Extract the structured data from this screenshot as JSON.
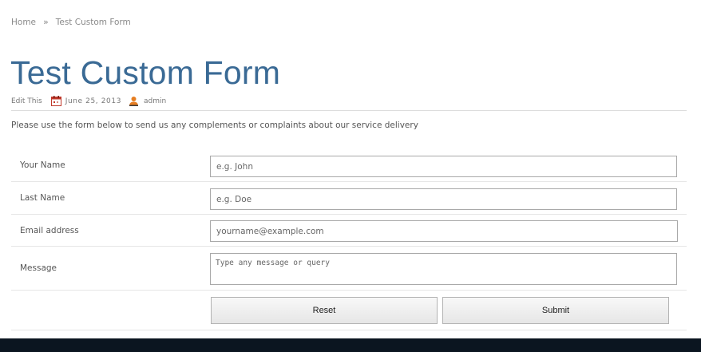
{
  "breadcrumb": {
    "home": "Home",
    "separator": "»",
    "current": "Test Custom Form"
  },
  "page": {
    "title": "Test Custom Form",
    "title_color": "#3a6a95"
  },
  "meta": {
    "edit_label": "Edit This",
    "date": "June 25, 2013",
    "author": "admin"
  },
  "intro_text": "Please use the form below to send us any complements or complaints about our service delivery",
  "form": {
    "fields": [
      {
        "label": "Your Name",
        "value": "",
        "placeholder": "e.g. John"
      },
      {
        "label": "Last Name",
        "value": "",
        "placeholder": "e.g. Doe"
      },
      {
        "label": "Email address",
        "value": "",
        "placeholder": "yourname@example.com"
      },
      {
        "label": "Message",
        "value": "",
        "placeholder": "Type any message or query"
      }
    ],
    "reset_label": "Reset",
    "submit_label": "Submit"
  },
  "colors": {
    "footer": "#0b1520",
    "calendar_icon": "#c0392b",
    "user_icon": "#e67e22"
  },
  "icons": {
    "date": "calendar-icon",
    "author": "user-icon"
  }
}
